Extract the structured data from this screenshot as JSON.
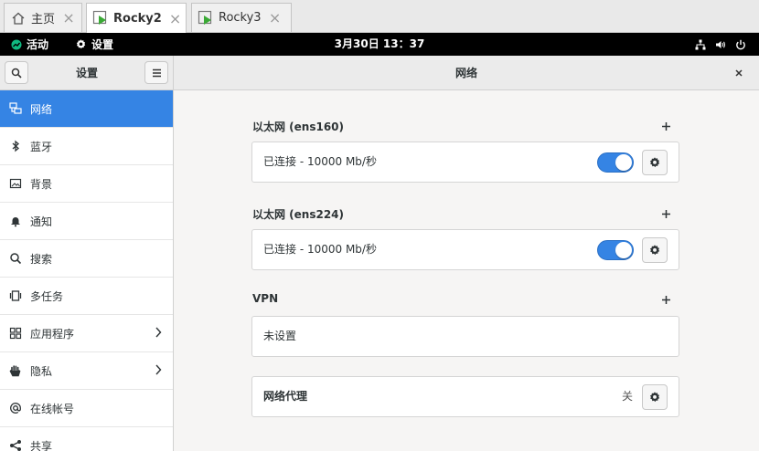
{
  "vm_tabs": [
    {
      "label": "主页",
      "icon": "home-icon",
      "active": false
    },
    {
      "label": "Rocky2",
      "icon": "vm-icon",
      "active": true
    },
    {
      "label": "Rocky3",
      "icon": "vm-icon",
      "active": false
    }
  ],
  "topbar": {
    "activities": "活动",
    "app_name": "设置",
    "clock": "3月30日 13：37"
  },
  "sidebar": {
    "title": "设置",
    "items": [
      {
        "label": "网络",
        "icon": "network-icon"
      },
      {
        "label": "蓝牙",
        "icon": "bluetooth-icon"
      },
      {
        "label": "背景",
        "icon": "background-icon"
      },
      {
        "label": "通知",
        "icon": "bell-icon"
      },
      {
        "label": "搜索",
        "icon": "search-icon"
      },
      {
        "label": "多任务",
        "icon": "multitasking-icon"
      },
      {
        "label": "应用程序",
        "icon": "apps-icon"
      },
      {
        "label": "隐私",
        "icon": "hand-icon"
      },
      {
        "label": "在线帐号",
        "icon": "at-icon"
      },
      {
        "label": "共享",
        "icon": "share-icon"
      }
    ]
  },
  "main": {
    "title": "网络",
    "sections": [
      {
        "title": "以太网 (ens160)",
        "status": "已连接 - 10000 Mb/秒"
      },
      {
        "title": "以太网 (ens224)",
        "status": "已连接 - 10000 Mb/秒"
      },
      {
        "title": "VPN",
        "status": "未设置"
      }
    ],
    "proxy": {
      "label": "网络代理",
      "state": "关"
    }
  },
  "colors": {
    "accent": "#3584e4",
    "topbar": "#000000",
    "header": "#ebebeb"
  }
}
